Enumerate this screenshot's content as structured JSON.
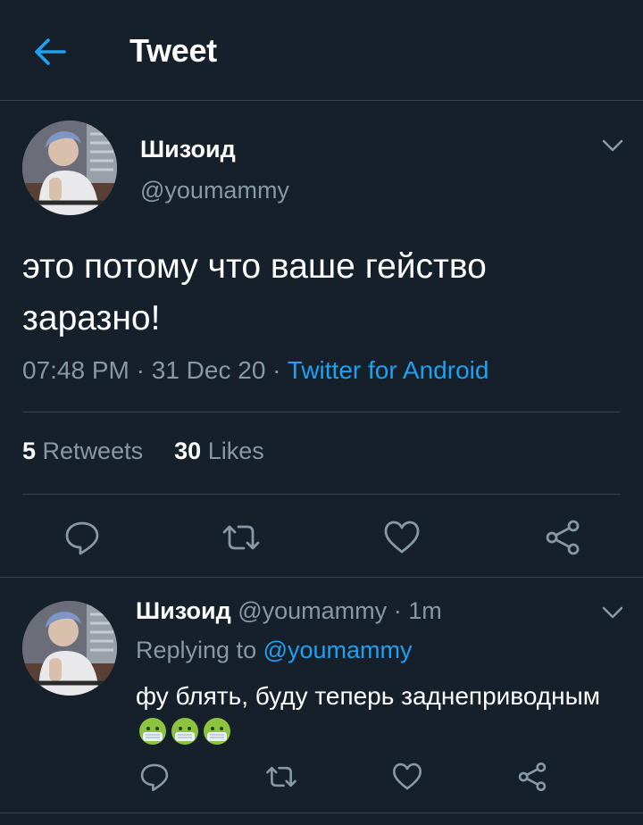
{
  "header": {
    "title": "Tweet",
    "back_icon": "arrow-left-icon",
    "accent": "#1da1f2"
  },
  "tweet": {
    "display_name": "Шизоид",
    "handle": "@youmammy",
    "text": "это потому что ваше гейство заразно!",
    "time": "07:48 PM",
    "date": "31 Dec 20",
    "source": "Twitter for Android",
    "retweets_count": "5",
    "retweets_label": "Retweets",
    "likes_count": "30",
    "likes_label": "Likes"
  },
  "reply": {
    "display_name": "Шизоид",
    "handle": "@youmammy",
    "age": "1m",
    "replying_prefix": "Replying to",
    "replying_to": "@youmammy",
    "text": "фу блять, буду теперь заднеприводным",
    "emojis": [
      "nauseated-face-icon",
      "nauseated-face-icon",
      "nauseated-face-icon"
    ]
  },
  "colors": {
    "background": "#15202b",
    "border": "#38444d",
    "secondary": "#8899a6",
    "link": "#1da1f2"
  }
}
